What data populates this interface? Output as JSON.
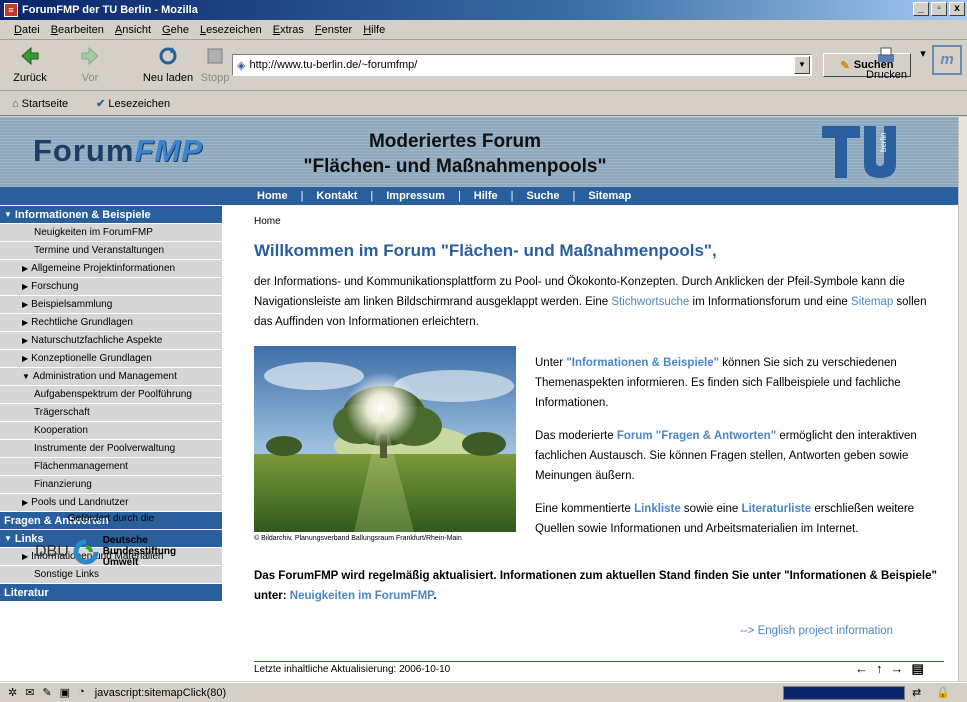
{
  "window": {
    "title": "ForumFMP der TU Berlin - Mozilla",
    "min": "_",
    "max": "▫",
    "close": "x"
  },
  "menu": [
    "Datei",
    "Bearbeiten",
    "Ansicht",
    "Gehe",
    "Lesezeichen",
    "Extras",
    "Fenster",
    "Hilfe"
  ],
  "toolbar": {
    "back": "Zurück",
    "forward": "Vor",
    "reload": "Neu laden",
    "stop": "Stopp",
    "url": "http://www.tu-berlin.de/~forumfmp/",
    "search": "Suchen",
    "print": "Drucken"
  },
  "bookmarks": {
    "home": "Startseite",
    "bookmarks": "Lesezeichen"
  },
  "banner": {
    "logo_a": "Forum",
    "logo_b": "FMP",
    "title_line1": "Moderiertes Forum",
    "title_line2": "\"Flächen- und Maßnahmenpools\""
  },
  "topnav": [
    "Home",
    "Kontakt",
    "Impressum",
    "Hilfe",
    "Suche",
    "Sitemap"
  ],
  "sidebar": {
    "section1": "Informationen & Beispiele",
    "s1_items": [
      {
        "label": "Neuigkeiten im ForumFMP",
        "kind": "sub"
      },
      {
        "label": "Termine und Veranstaltungen",
        "kind": "sub"
      },
      {
        "label": "Allgemeine Projektinformationen",
        "kind": "tri"
      },
      {
        "label": "Forschung",
        "kind": "tri"
      },
      {
        "label": "Beispielsammlung",
        "kind": "tri"
      },
      {
        "label": "Rechtliche Grundlagen",
        "kind": "tri"
      },
      {
        "label": "Naturschutzfachliche Aspekte",
        "kind": "tri"
      },
      {
        "label": "Konzeptionelle Grundlagen",
        "kind": "tri"
      },
      {
        "label": "Administration und Management",
        "kind": "open"
      },
      {
        "label": "Aufgabenspektrum der Poolführung",
        "kind": "sub"
      },
      {
        "label": "Trägerschaft",
        "kind": "sub"
      },
      {
        "label": "Kooperation",
        "kind": "sub"
      },
      {
        "label": "Instrumente der Poolverwaltung",
        "kind": "sub"
      },
      {
        "label": "Flächenmanagement",
        "kind": "sub"
      },
      {
        "label": "Finanzierung",
        "kind": "sub"
      },
      {
        "label": "Pools und Landnutzer",
        "kind": "tri"
      }
    ],
    "section2": "Fragen & Antworten",
    "section3": "Links",
    "s3_items": [
      {
        "label": "Informationen und Materialien",
        "kind": "tri"
      },
      {
        "label": "Sonstige Links",
        "kind": "sub"
      }
    ],
    "section4": "Literatur",
    "funded": "Gefördert durch die",
    "dbu": "DBU",
    "dbu_name1": "Deutsche",
    "dbu_name2": "Bundesstiftung",
    "dbu_name3": "Umwelt"
  },
  "content": {
    "crumb": "Home",
    "welcome": "Willkommen im Forum \"Flächen- und Maßnahmenpools\",",
    "intro_a": "der Informations- und Kommunikationsplattform zu Pool- und Ökokonto-Konzepten. Durch Anklicken der Pfeil-Symbole kann die Navigationsleiste am linken Bildschirmrand ausgeklappt werden. Eine ",
    "intro_link1": "Stichwortsuche",
    "intro_b": " im Informationsforum und eine ",
    "intro_link2": "Sitemap",
    "intro_c": " sollen das Auffinden von Informationen erleichtern.",
    "p1_a": "Unter ",
    "p1_link": "\"Informationen & Beispiele\"",
    "p1_b": " können Sie sich zu verschiedenen Themenaspekten informieren. Es finden sich Fallbeispiele und fachliche Informationen.",
    "p2_a": "Das moderierte ",
    "p2_link": "Forum \"Fragen & Antworten\"",
    "p2_b": " ermöglicht den interaktiven fachlichen Austausch. Sie können Fragen stellen, Antworten geben sowie Meinungen äußern.",
    "p3_a": "Eine kommentierte ",
    "p3_link1": "Linkliste",
    "p3_b": " sowie eine ",
    "p3_link2": "Literaturliste",
    "p3_c": " erschließen weitere Quellen sowie Informationen und Arbeitsmaterialien im Internet.",
    "photo_caption": "© Bildarchiv, Planungsverband Ballungsraum Frankfurt/Rhein-Main",
    "update_a": "Das ForumFMP wird regelmäßig aktualisiert. Informationen zum aktuellen Stand finden Sie unter \"Informationen & Beispiele\" unter: ",
    "update_link": "Neuigkeiten im ForumFMP",
    "update_end": ".",
    "english": "--> English project information",
    "last_update": "Letzte inhaltliche Aktualisierung: 2006-10-10"
  },
  "status": {
    "text": "javascript:sitemapClick(80)"
  }
}
